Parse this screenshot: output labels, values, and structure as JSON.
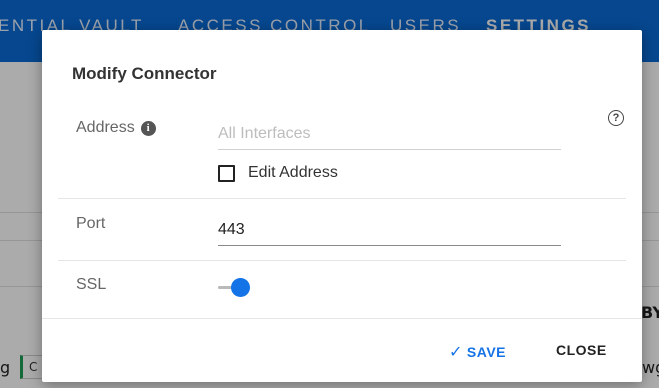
{
  "nav": {
    "items": [
      "ENTIAL VAULT",
      "ACCESS CONTROL",
      "USERS",
      "SETTINGS"
    ]
  },
  "background": {
    "right_text": "BY",
    "bottom_left_text": "g",
    "chip_text": "C",
    "bottom_right_text": "wg"
  },
  "dialog": {
    "title": "Modify Connector",
    "help_glyph": "?",
    "address": {
      "label": "Address",
      "info_glyph": "i",
      "placeholder": "All Interfaces",
      "value": "",
      "edit_checkbox_label": "Edit Address",
      "edit_checked": false
    },
    "port": {
      "label": "Port",
      "value": "443"
    },
    "ssl": {
      "label": "SSL",
      "enabled": true
    },
    "save_label": "SAVE",
    "close_label": "CLOSE"
  },
  "colors": {
    "nav_bg": "#0a6ad6",
    "accent": "#1473e6"
  }
}
